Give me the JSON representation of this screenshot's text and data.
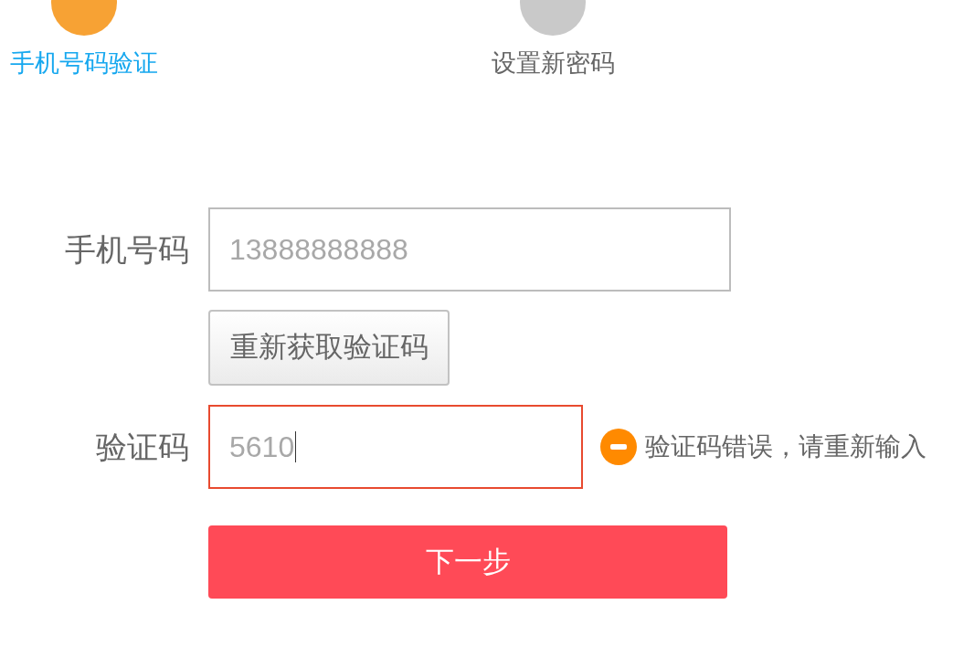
{
  "steps": [
    {
      "label": "手机号码验证",
      "active": true
    },
    {
      "label": "设置新密码",
      "active": false
    }
  ],
  "form": {
    "phone": {
      "label": "手机号码",
      "value": "13888888888",
      "focused": false,
      "invalid": false
    },
    "resend_button": "重新获取验证码",
    "code": {
      "label": "验证码",
      "value": "5610",
      "focused": true,
      "invalid": true,
      "error": "验证码错误，请重新输入"
    },
    "next_button": "下一步"
  }
}
